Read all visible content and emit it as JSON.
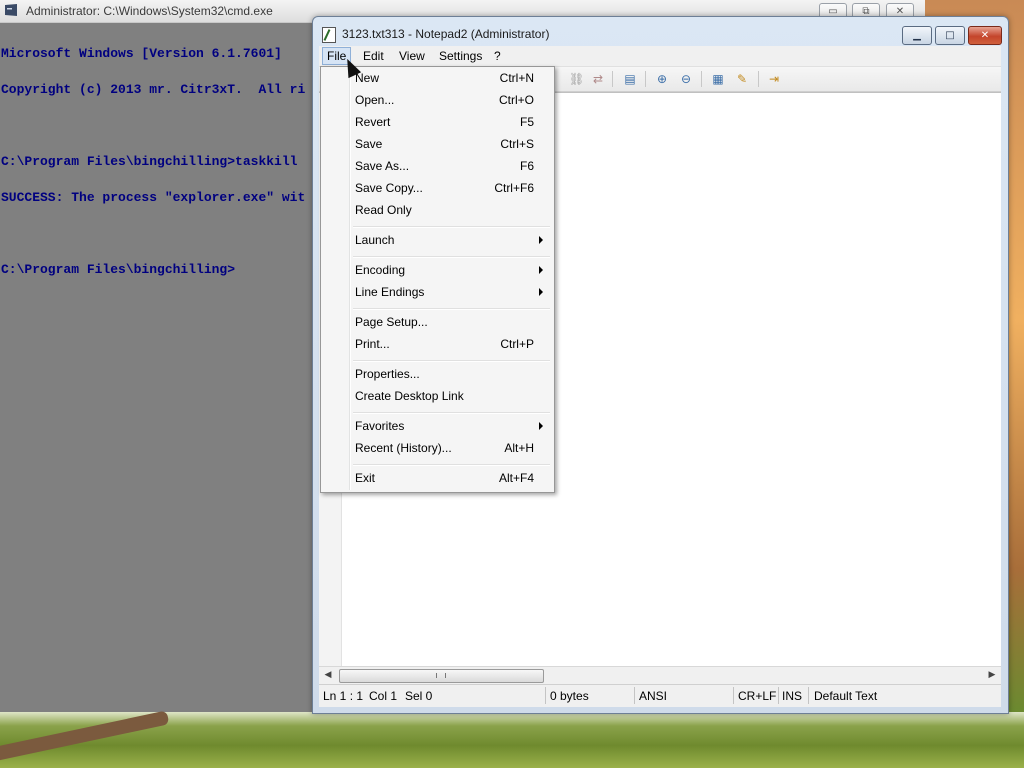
{
  "cmd": {
    "title": "Administrator: C:\\Windows\\System32\\cmd.exe",
    "lines": [
      "Microsoft Windows [Version 6.1.7601]",
      "Copyright (c) 2013 mr. Citr3xT.  All ri",
      "",
      "C:\\Program Files\\bingchilling>taskkill",
      "SUCCESS: The process \"explorer.exe\" wit",
      "",
      "C:\\Program Files\\bingchilling>"
    ],
    "buttons": {
      "minimize": "▭",
      "maximize": "⧉",
      "close": "✕"
    }
  },
  "notepad": {
    "title": "3123.txt313 - Notepad2 (Administrator)",
    "buttons": {
      "minimize": "▁",
      "maximize": "□",
      "close": "✕"
    },
    "menu": [
      "File",
      "Edit",
      "View",
      "Settings",
      "?"
    ],
    "active_menu": "File",
    "toolbar_icons": [
      "find-icon",
      "replace-icon",
      "word-wrap-icon",
      "zoom-in-icon",
      "zoom-out-icon",
      "scheme-icon",
      "customize-scheme-icon",
      "exit-icon"
    ],
    "statusbar": {
      "position": "Ln 1 : 1",
      "column": "Col 1",
      "selection": "Sel 0",
      "size": "0 bytes",
      "encoding": "ANSI",
      "line_endings": "CR+LF",
      "insert_mode": "INS",
      "scheme": "Default Text"
    }
  },
  "file_menu": {
    "items": [
      {
        "label": "New",
        "shortcut": "Ctrl+N"
      },
      {
        "label": "Open...",
        "shortcut": "Ctrl+O"
      },
      {
        "label": "Revert",
        "shortcut": "F5"
      },
      {
        "label": "Save",
        "shortcut": "Ctrl+S"
      },
      {
        "label": "Save As...",
        "shortcut": "F6"
      },
      {
        "label": "Save Copy...",
        "shortcut": "Ctrl+F6"
      },
      {
        "label": "Read Only",
        "shortcut": ""
      },
      {
        "label": "Launch",
        "shortcut": "",
        "submenu": true
      },
      {
        "label": "Encoding",
        "shortcut": "",
        "submenu": true
      },
      {
        "label": "Line Endings",
        "shortcut": "",
        "submenu": true
      },
      {
        "label": "Page Setup...",
        "shortcut": ""
      },
      {
        "label": "Print...",
        "shortcut": "Ctrl+P"
      },
      {
        "label": "Properties...",
        "shortcut": ""
      },
      {
        "label": "Create Desktop Link",
        "shortcut": ""
      },
      {
        "label": "Favorites",
        "shortcut": "",
        "submenu": true
      },
      {
        "label": "Recent (History)...",
        "shortcut": "Alt+H"
      },
      {
        "label": "Exit",
        "shortcut": "Alt+F4"
      }
    ]
  }
}
